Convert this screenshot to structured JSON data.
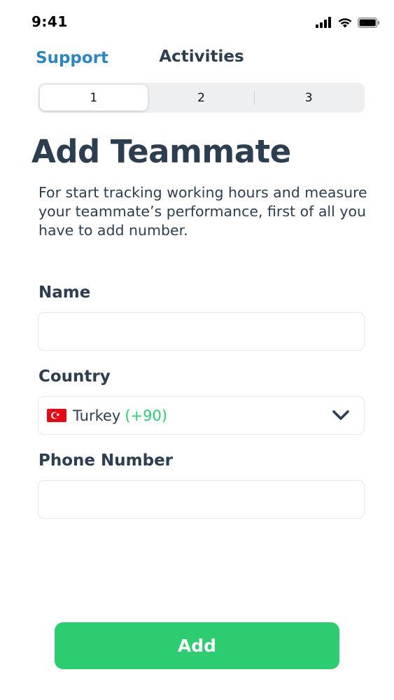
{
  "status_bar": {
    "time": "9:41"
  },
  "nav": {
    "left_label": "Support",
    "title": "Activities"
  },
  "steps": {
    "items": [
      "1",
      "2",
      "3"
    ],
    "selected": "1"
  },
  "heading": {
    "title": "Add Teammate",
    "description": "For start tracking working hours and measure your teammate’s performance, first of all you have to add number."
  },
  "form": {
    "name": {
      "label": "Name",
      "value": ""
    },
    "country": {
      "label": "Country",
      "value": "Turkey",
      "dial_code": "(+90)",
      "flag_icon": "turkey-flag-icon"
    },
    "phone": {
      "label": "Phone Number",
      "value": ""
    }
  },
  "actions": {
    "add_label": "Add"
  },
  "colors": {
    "accent_green": "#2ecc71",
    "link_blue": "#2e86c1",
    "text_dark": "#2c3e50"
  }
}
